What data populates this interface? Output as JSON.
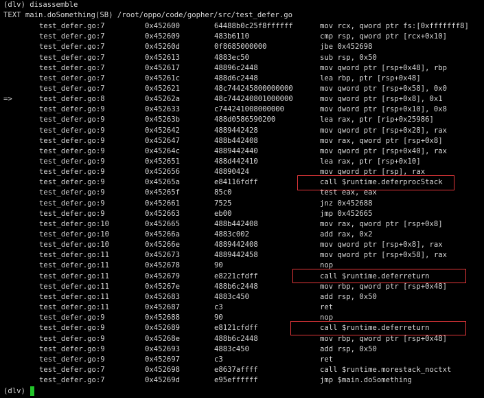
{
  "accent": {
    "highlight_box_color": "#e8383b",
    "cursor_color": "#22c42a"
  },
  "header": {
    "command": "(dlv) disassemble",
    "text_line": "TEXT main.doSomething(SB) /root/oppo/code/gopher/src/test_defer.go"
  },
  "rows": [
    {
      "arrow": "",
      "file": "test_defer.go:7",
      "addr": "0x452600",
      "bytes": "64488b0c25f8ffffff",
      "asm": "mov rcx, qword ptr fs:[0xfffffff8]"
    },
    {
      "arrow": "",
      "file": "test_defer.go:7",
      "addr": "0x452609",
      "bytes": "483b6110",
      "asm": "cmp rsp, qword ptr [rcx+0x10]"
    },
    {
      "arrow": "",
      "file": "test_defer.go:7",
      "addr": "0x45260d",
      "bytes": "0f8685000000",
      "asm": "jbe 0x452698"
    },
    {
      "arrow": "",
      "file": "test_defer.go:7",
      "addr": "0x452613",
      "bytes": "4883ec50",
      "asm": "sub rsp, 0x50"
    },
    {
      "arrow": "",
      "file": "test_defer.go:7",
      "addr": "0x452617",
      "bytes": "48896c2448",
      "asm": "mov qword ptr [rsp+0x48], rbp"
    },
    {
      "arrow": "",
      "file": "test_defer.go:7",
      "addr": "0x45261c",
      "bytes": "488d6c2448",
      "asm": "lea rbp, ptr [rsp+0x48]"
    },
    {
      "arrow": "",
      "file": "test_defer.go:7",
      "addr": "0x452621",
      "bytes": "48c744245800000000",
      "asm": "mov qword ptr [rsp+0x58], 0x0"
    },
    {
      "arrow": "=>",
      "file": "test_defer.go:8",
      "addr": "0x45262a",
      "bytes": "48c744240801000000",
      "asm": "mov qword ptr [rsp+0x8], 0x1"
    },
    {
      "arrow": "",
      "file": "test_defer.go:9",
      "addr": "0x452633",
      "bytes": "c744241008000000",
      "asm": "mov dword ptr [rsp+0x10], 0x8"
    },
    {
      "arrow": "",
      "file": "test_defer.go:9",
      "addr": "0x45263b",
      "bytes": "488d0586590200",
      "asm": "lea rax, ptr [rip+0x25986]"
    },
    {
      "arrow": "",
      "file": "test_defer.go:9",
      "addr": "0x452642",
      "bytes": "4889442428",
      "asm": "mov qword ptr [rsp+0x28], rax"
    },
    {
      "arrow": "",
      "file": "test_defer.go:9",
      "addr": "0x452647",
      "bytes": "488b442408",
      "asm": "mov rax, qword ptr [rsp+0x8]"
    },
    {
      "arrow": "",
      "file": "test_defer.go:9",
      "addr": "0x45264c",
      "bytes": "4889442440",
      "asm": "mov qword ptr [rsp+0x40], rax"
    },
    {
      "arrow": "",
      "file": "test_defer.go:9",
      "addr": "0x452651",
      "bytes": "488d442410",
      "asm": "lea rax, ptr [rsp+0x10]"
    },
    {
      "arrow": "",
      "file": "test_defer.go:9",
      "addr": "0x452656",
      "bytes": "48890424",
      "asm": "mov qword ptr [rsp], rax"
    },
    {
      "arrow": "",
      "file": "test_defer.go:9",
      "addr": "0x45265a",
      "bytes": "e84116fdff",
      "asm": "call $runtime.deferprocStack"
    },
    {
      "arrow": "",
      "file": "test_defer.go:9",
      "addr": "0x45265f",
      "bytes": "85c0",
      "asm": "test eax, eax"
    },
    {
      "arrow": "",
      "file": "test_defer.go:9",
      "addr": "0x452661",
      "bytes": "7525",
      "asm": "jnz 0x452688"
    },
    {
      "arrow": "",
      "file": "test_defer.go:9",
      "addr": "0x452663",
      "bytes": "eb00",
      "asm": "jmp 0x452665"
    },
    {
      "arrow": "",
      "file": "test_defer.go:10",
      "addr": "0x452665",
      "bytes": "488b442408",
      "asm": "mov rax, qword ptr [rsp+0x8]"
    },
    {
      "arrow": "",
      "file": "test_defer.go:10",
      "addr": "0x45266a",
      "bytes": "4883c002",
      "asm": "add rax, 0x2"
    },
    {
      "arrow": "",
      "file": "test_defer.go:10",
      "addr": "0x45266e",
      "bytes": "4889442408",
      "asm": "mov qword ptr [rsp+0x8], rax"
    },
    {
      "arrow": "",
      "file": "test_defer.go:11",
      "addr": "0x452673",
      "bytes": "4889442458",
      "asm": "mov qword ptr [rsp+0x58], rax"
    },
    {
      "arrow": "",
      "file": "test_defer.go:11",
      "addr": "0x452678",
      "bytes": "90",
      "asm": "nop"
    },
    {
      "arrow": "",
      "file": "test_defer.go:11",
      "addr": "0x452679",
      "bytes": "e8221cfdff",
      "asm": "call $runtime.deferreturn"
    },
    {
      "arrow": "",
      "file": "test_defer.go:11",
      "addr": "0x45267e",
      "bytes": "488b6c2448",
      "asm": "mov rbp, qword ptr [rsp+0x48]"
    },
    {
      "arrow": "",
      "file": "test_defer.go:11",
      "addr": "0x452683",
      "bytes": "4883c450",
      "asm": "add rsp, 0x50"
    },
    {
      "arrow": "",
      "file": "test_defer.go:11",
      "addr": "0x452687",
      "bytes": "c3",
      "asm": "ret"
    },
    {
      "arrow": "",
      "file": "test_defer.go:9",
      "addr": "0x452688",
      "bytes": "90",
      "asm": "nop"
    },
    {
      "arrow": "",
      "file": "test_defer.go:9",
      "addr": "0x452689",
      "bytes": "e8121cfdff",
      "asm": "call $runtime.deferreturn"
    },
    {
      "arrow": "",
      "file": "test_defer.go:9",
      "addr": "0x45268e",
      "bytes": "488b6c2448",
      "asm": "mov rbp, qword ptr [rsp+0x48]"
    },
    {
      "arrow": "",
      "file": "test_defer.go:9",
      "addr": "0x452693",
      "bytes": "4883c450",
      "asm": "add rsp, 0x50"
    },
    {
      "arrow": "",
      "file": "test_defer.go:9",
      "addr": "0x452697",
      "bytes": "c3",
      "asm": "ret"
    },
    {
      "arrow": "",
      "file": "test_defer.go:7",
      "addr": "0x452698",
      "bytes": "e8637affff",
      "asm": "call $runtime.morestack_noctxt"
    },
    {
      "arrow": "",
      "file": "test_defer.go:7",
      "addr": "0x45269d",
      "bytes": "e95effffff",
      "asm": "jmp $main.doSomething"
    }
  ],
  "prompt": {
    "label": "(dlv)"
  }
}
